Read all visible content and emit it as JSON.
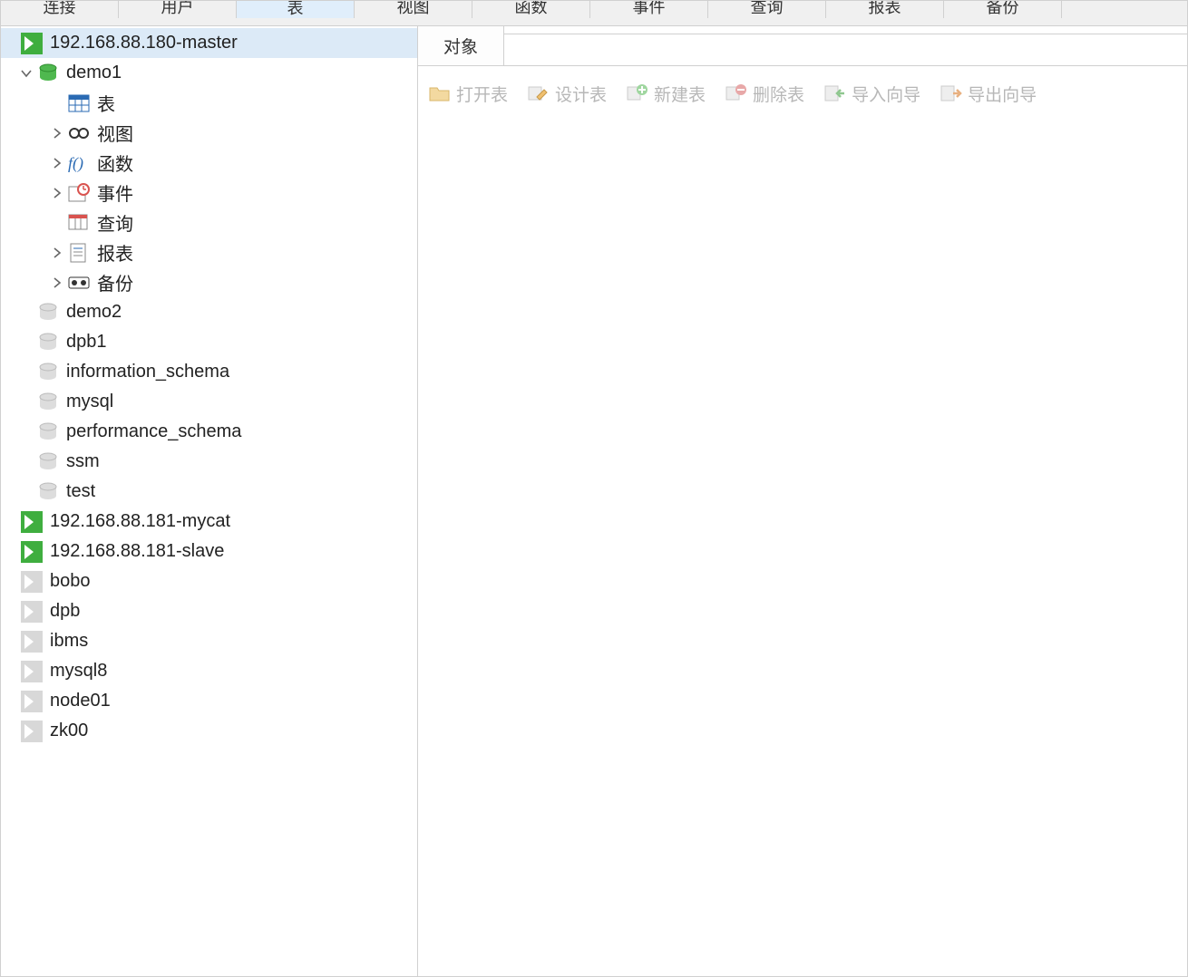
{
  "topTabs": {
    "items": [
      {
        "label": "连接"
      },
      {
        "label": "用户"
      },
      {
        "label": "表"
      },
      {
        "label": "视图"
      },
      {
        "label": "函数"
      },
      {
        "label": "事件"
      },
      {
        "label": "查询"
      },
      {
        "label": "报表"
      },
      {
        "label": "备份"
      }
    ]
  },
  "tree": {
    "connections": [
      {
        "label": "192.168.88.180-master",
        "active": true,
        "selected": true,
        "expanded": true,
        "databases": [
          {
            "label": "demo1",
            "open": true,
            "expanded": true,
            "children": [
              {
                "label": "表",
                "icon": "table",
                "expandable": false
              },
              {
                "label": "视图",
                "icon": "view",
                "expandable": true
              },
              {
                "label": "函数",
                "icon": "function",
                "expandable": true
              },
              {
                "label": "事件",
                "icon": "event",
                "expandable": true
              },
              {
                "label": "查询",
                "icon": "query",
                "expandable": false
              },
              {
                "label": "报表",
                "icon": "report",
                "expandable": true
              },
              {
                "label": "备份",
                "icon": "backup",
                "expandable": true
              }
            ]
          },
          {
            "label": "demo2",
            "open": false
          },
          {
            "label": "dpb1",
            "open": false
          },
          {
            "label": "information_schema",
            "open": false
          },
          {
            "label": "mysql",
            "open": false
          },
          {
            "label": "performance_schema",
            "open": false
          },
          {
            "label": "ssm",
            "open": false
          },
          {
            "label": "test",
            "open": false
          }
        ]
      },
      {
        "label": "192.168.88.181-mycat",
        "active": true
      },
      {
        "label": "192.168.88.181-slave",
        "active": true
      },
      {
        "label": "bobo",
        "active": false
      },
      {
        "label": "dpb",
        "active": false
      },
      {
        "label": "ibms",
        "active": false
      },
      {
        "label": "mysql8",
        "active": false
      },
      {
        "label": "node01",
        "active": false
      },
      {
        "label": "zk00",
        "active": false
      }
    ]
  },
  "rightPane": {
    "tabLabel": "对象",
    "toolbar": {
      "open": "打开表",
      "design": "设计表",
      "new": "新建表",
      "delete": "删除表",
      "import": "导入向导",
      "export": "导出向导"
    }
  }
}
